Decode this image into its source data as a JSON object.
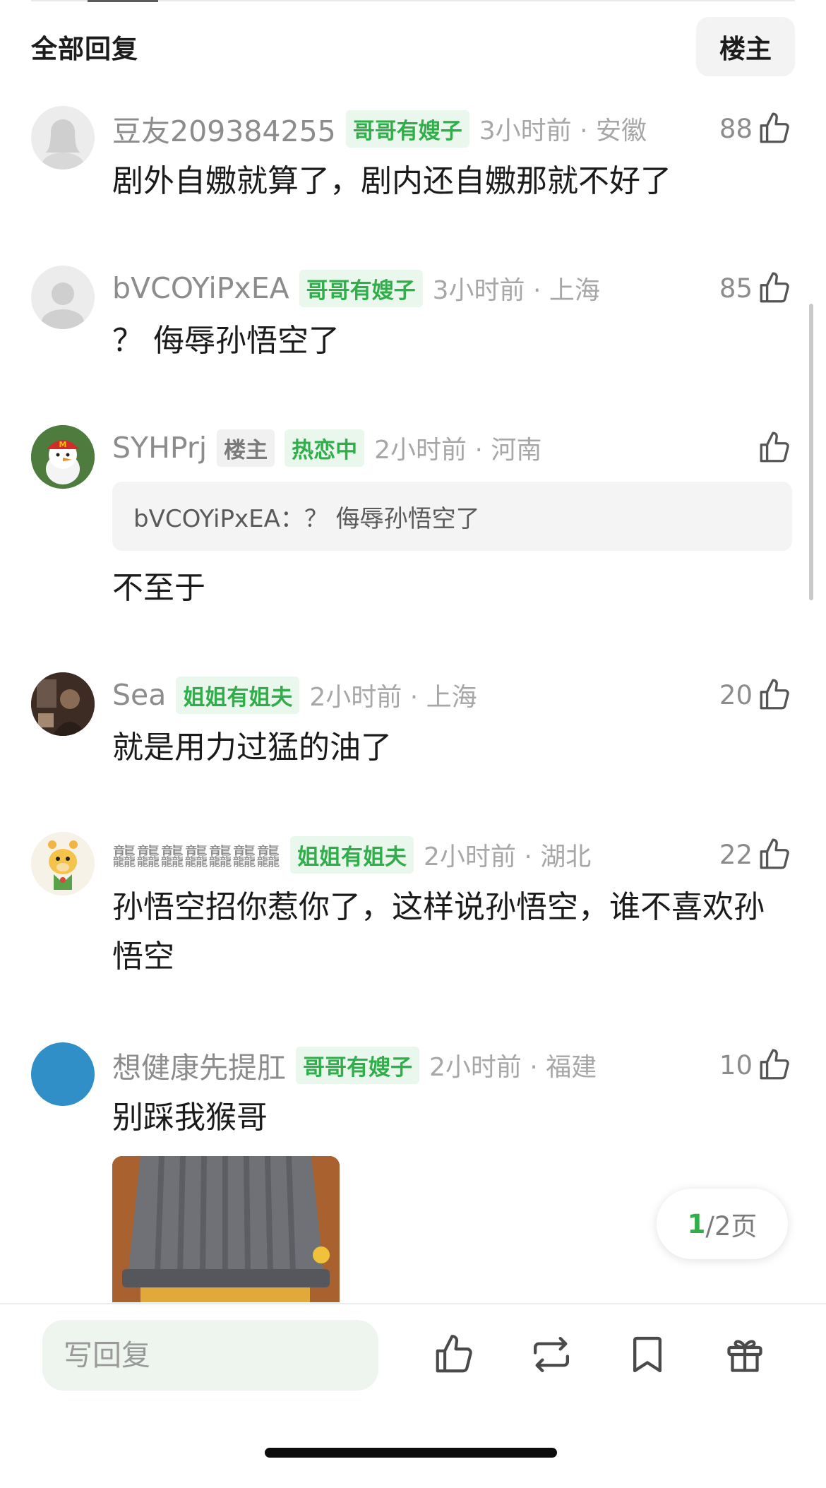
{
  "header": {
    "title": "全部回复",
    "owner_button": "楼主"
  },
  "comments": [
    {
      "username": "豆友209384255",
      "tags": [
        "哥哥有嫂子"
      ],
      "time": "3小时前 · 安徽",
      "likes": "88",
      "text": "剧外自嫐就算了，剧内还自嫐那就不好了",
      "avatar": "default-female-avatar"
    },
    {
      "username": "bVCOYiPxEA",
      "tags": [
        "哥哥有嫂子"
      ],
      "time": "3小时前 · 上海",
      "likes": "85",
      "text": "？ 侮辱孙悟空了",
      "avatar": "default-avatar"
    },
    {
      "username": "SYHPrj",
      "tags": [
        "楼主",
        "热恋中"
      ],
      "time": "2小时前 · 河南",
      "likes": "",
      "quote": "bVCOYiPxEA：？ 侮辱孙悟空了",
      "text": "不至于",
      "avatar": "snowman-avatar"
    },
    {
      "username": "Sea",
      "tags": [
        "姐姐有姐夫"
      ],
      "time": "2小时前 · 上海",
      "likes": "20",
      "text": "就是用力过猛的油了",
      "avatar": "photo-avatar"
    },
    {
      "username": "龘龘龘龘龘龘龘",
      "tags": [
        "姐姐有姐夫"
      ],
      "time": "2小时前 · 湖北",
      "likes": "22",
      "text": "孙悟空招你惹你了，这样说孙悟空，谁不喜欢孙悟空",
      "avatar": "giraffe-avatar"
    },
    {
      "username": "想健康先提肛",
      "tags": [
        "哥哥有嫂子"
      ],
      "time": "2小时前 · 福建",
      "likes": "10",
      "text": "别踩我猴哥",
      "avatar": "blue-circle-avatar"
    }
  ],
  "pager": {
    "current": "1",
    "total": "/2页"
  },
  "bottom_bar": {
    "reply_placeholder": "写回复"
  },
  "colors": {
    "accent_green": "#2fae4a",
    "tag_bg": "#eaf7ec"
  }
}
